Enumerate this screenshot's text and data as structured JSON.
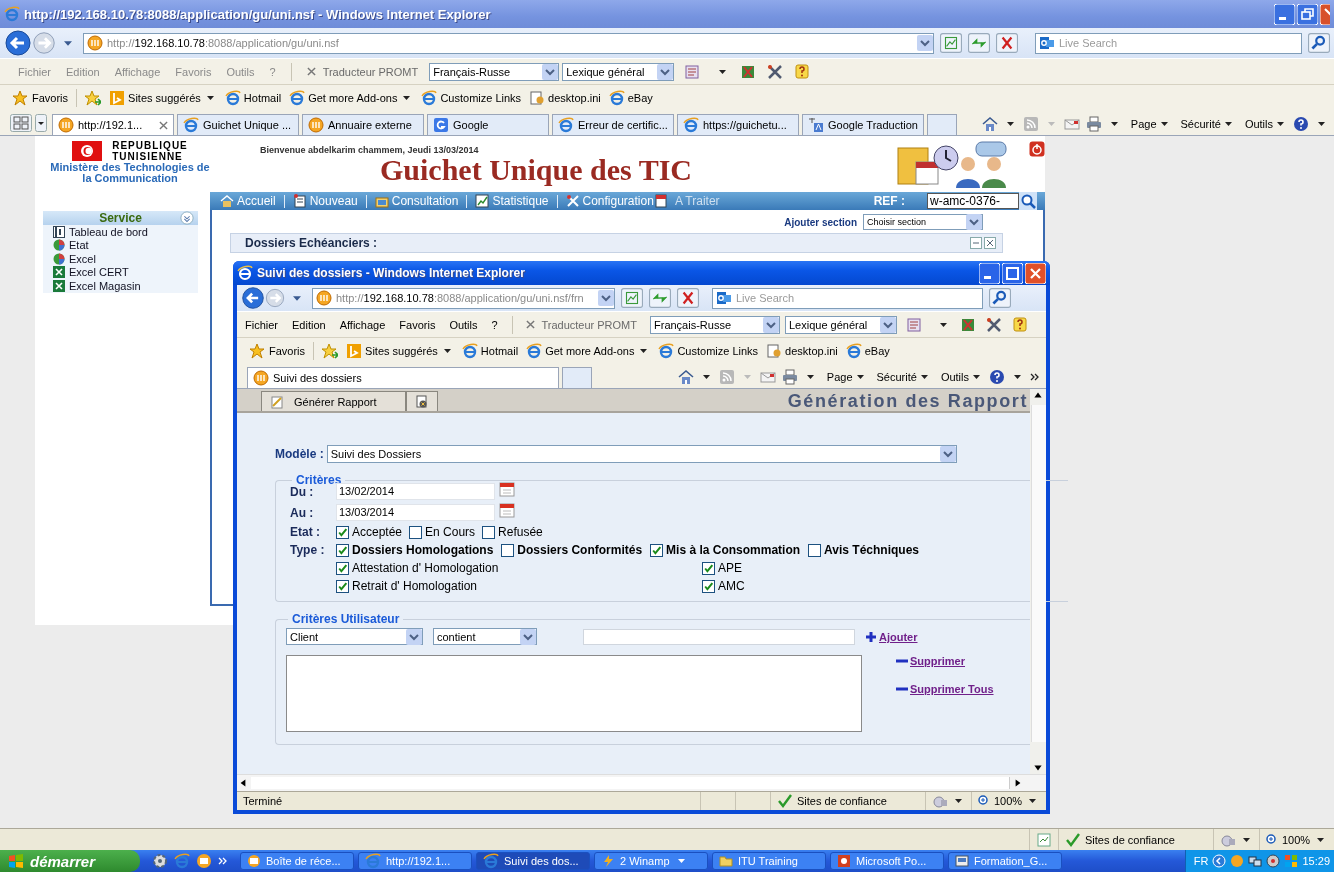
{
  "window": {
    "title": "http://192.168.10.78:8088/application/gu/uni.nsf - Windows Internet Explorer",
    "active": false,
    "quick_tabs": true,
    "address": {
      "scheme": "http://",
      "host": "192.168.10.78",
      "path": ":8088/application/gu/uni.nsf"
    },
    "search_placeholder": "Live Search",
    "menu": [
      "Fichier",
      "Edition",
      "Affichage",
      "Favoris",
      "Outils",
      "?"
    ],
    "translator": {
      "label": "Traducteur PROMT",
      "language": "Français-Russe",
      "lexicon": "Lexique général"
    },
    "favorites": {
      "label": "Favoris",
      "links": [
        {
          "label": "Sites suggérés",
          "kind": "suggested",
          "dropdown": true
        },
        {
          "label": "Hotmail",
          "kind": "page",
          "dropdown": false
        },
        {
          "label": "Get more Add-ons",
          "kind": "page",
          "dropdown": true
        },
        {
          "label": "Customize Links",
          "kind": "page",
          "dropdown": false
        },
        {
          "label": "desktop.ini",
          "kind": "file",
          "dropdown": false
        },
        {
          "label": "eBay",
          "kind": "page",
          "dropdown": false
        }
      ]
    },
    "tabs": [
      {
        "label": "http://192.1...",
        "kind": "site",
        "selected": true
      },
      {
        "label": "Guichet Unique ...",
        "kind": "page",
        "selected": false
      },
      {
        "label": "Annuaire externe",
        "kind": "site",
        "selected": false
      },
      {
        "label": "Google",
        "kind": "google",
        "selected": false
      },
      {
        "label": "Erreur de certific...",
        "kind": "page",
        "selected": false
      },
      {
        "label": "https://guichetu...",
        "kind": "page",
        "selected": false
      },
      {
        "label": "Google Traduction",
        "kind": "translate",
        "selected": false
      }
    ],
    "commands": [
      "Page",
      "Sécurité",
      "Outils"
    ]
  },
  "page": {
    "republic": [
      "REPUBLIQUE",
      "TUNISIENNE"
    ],
    "ministry": "Ministère des Technologies de la Communication",
    "welcome": "Bienvenue abdelkarim chammem, Jeudi 13/03/2014",
    "title": "Guichet Unique des TIC",
    "nav": [
      {
        "label": "Accueil",
        "kind": "home"
      },
      {
        "label": "Nouveau",
        "kind": "new"
      },
      {
        "label": "Consultation",
        "kind": "consult"
      },
      {
        "label": "Statistique",
        "kind": "stats"
      },
      {
        "label": "Configuration",
        "kind": "config"
      },
      {
        "label": "A Traiter",
        "kind": "todo"
      }
    ],
    "ref_label": "REF :",
    "ref_value": "w-amc-0376-",
    "sidebar": {
      "title": "Service",
      "items": [
        {
          "label": "Tableau de bord",
          "kind": "board"
        },
        {
          "label": "Etat",
          "kind": "chart"
        },
        {
          "label": "Excel",
          "kind": "chart"
        },
        {
          "label": "Excel CERT",
          "kind": "excel"
        },
        {
          "label": "Excel Magasin",
          "kind": "excel"
        }
      ]
    },
    "add_section_label": "Ajouter section",
    "section_select": "Choisir section",
    "panel_title": "Dossiers Echéanciers :"
  },
  "status_bar": {
    "zone": "Sites de confiance",
    "zoom": "100%"
  },
  "taskbar": {
    "start": "démarrer",
    "items": [
      {
        "label": "Boîte de réce...",
        "kind": "mail",
        "selected": false
      },
      {
        "label": "http://192.1...",
        "kind": "ie",
        "selected": false
      },
      {
        "label": "Suivi des dos...",
        "kind": "ie",
        "selected": true
      },
      {
        "label": "2 Winamp",
        "kind": "winamp",
        "selected": false
      },
      {
        "label": "ITU Training",
        "kind": "folder",
        "selected": false
      },
      {
        "label": "Microsoft Po...",
        "kind": "ppt",
        "selected": false
      },
      {
        "label": "Formation_G...",
        "kind": "doc",
        "selected": false
      }
    ],
    "language": "FR",
    "time": "15:29"
  },
  "popup": {
    "title": "Suivi des dossiers - Windows Internet Explorer",
    "active": true,
    "quick_tabs": false,
    "address": {
      "scheme": "http://",
      "host": "192.168.10.78",
      "path": ":8088/application/gu/uni.nsf/frn"
    },
    "search_placeholder": "Live Search",
    "menu": [
      "Fichier",
      "Edition",
      "Affichage",
      "Favoris",
      "Outils",
      "?"
    ],
    "translator": {
      "label": "Traducteur PROMT",
      "language": "Français-Russe",
      "lexicon": "Lexique général"
    },
    "favorites": {
      "label": "Favoris",
      "links": [
        {
          "label": "Sites suggérés",
          "kind": "suggested",
          "dropdown": true
        },
        {
          "label": "Hotmail",
          "kind": "page",
          "dropdown": false
        },
        {
          "label": "Get more Add-ons",
          "kind": "page",
          "dropdown": true
        },
        {
          "label": "Customize Links",
          "kind": "page",
          "dropdown": false
        },
        {
          "label": "desktop.ini",
          "kind": "file",
          "dropdown": false
        },
        {
          "label": "eBay",
          "kind": "page",
          "dropdown": false
        }
      ]
    },
    "tabs": [
      {
        "label": "Suivi des dossiers",
        "kind": "site",
        "selected": true
      }
    ],
    "commands": [
      "Page",
      "Sécurité",
      "Outils"
    ],
    "report": {
      "tab": "Générer Rapport",
      "heading": "Génération des Rapport",
      "model_label": "Modèle :",
      "model": "Suivi des Dossiers",
      "criteria_title": "Critères",
      "from_label": "Du :",
      "from": "13/02/2014",
      "to_label": "Au :",
      "to": "13/03/2014",
      "state_label": "Etat :",
      "states": [
        {
          "label": "Acceptée",
          "checked": true
        },
        {
          "label": "En Cours",
          "checked": false
        },
        {
          "label": "Refusée",
          "checked": false
        }
      ],
      "type_label": "Type :",
      "types": [
        {
          "label": "Dossiers Homologations",
          "checked": true
        },
        {
          "label": "Dossiers Conformités",
          "checked": false
        },
        {
          "label": "Mis à la Consommation",
          "checked": true
        },
        {
          "label": "Avis Téchniques",
          "checked": false
        }
      ],
      "subtype_columns": [
        [
          {
            "label": "Attestation d' Homologation",
            "checked": true
          },
          {
            "label": "Retrait d' Homologation",
            "checked": true
          }
        ],
        [
          {
            "label": "APE",
            "checked": true
          },
          {
            "label": "AMC",
            "checked": true
          }
        ]
      ],
      "user_criteria_title": "Critères Utilisateur",
      "field": "Client",
      "operator": "contient",
      "add": "Ajouter",
      "remove": "Supprimer",
      "remove_all": "Supprimer Tous"
    },
    "status_bar": {
      "text": "Terminé",
      "zone": "Sites de confiance",
      "zoom": "100%"
    }
  }
}
